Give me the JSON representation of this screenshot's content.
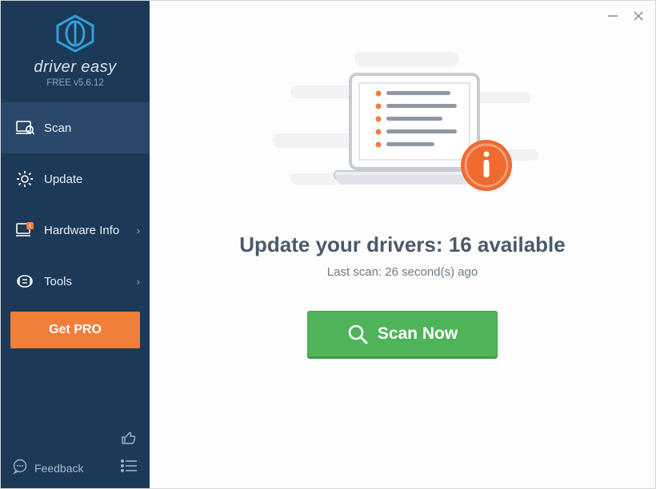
{
  "app": {
    "brand": "driver easy",
    "version_label": "FREE v5.6.12"
  },
  "sidebar": {
    "items": [
      {
        "label": "Scan"
      },
      {
        "label": "Update"
      },
      {
        "label": "Hardware Info"
      },
      {
        "label": "Tools"
      }
    ],
    "getpro_label": "Get PRO",
    "feedback_label": "Feedback"
  },
  "main": {
    "headline": "Update your drivers: 16 available",
    "last_scan": "Last scan: 26 second(s) ago",
    "scan_button": "Scan Now"
  }
}
